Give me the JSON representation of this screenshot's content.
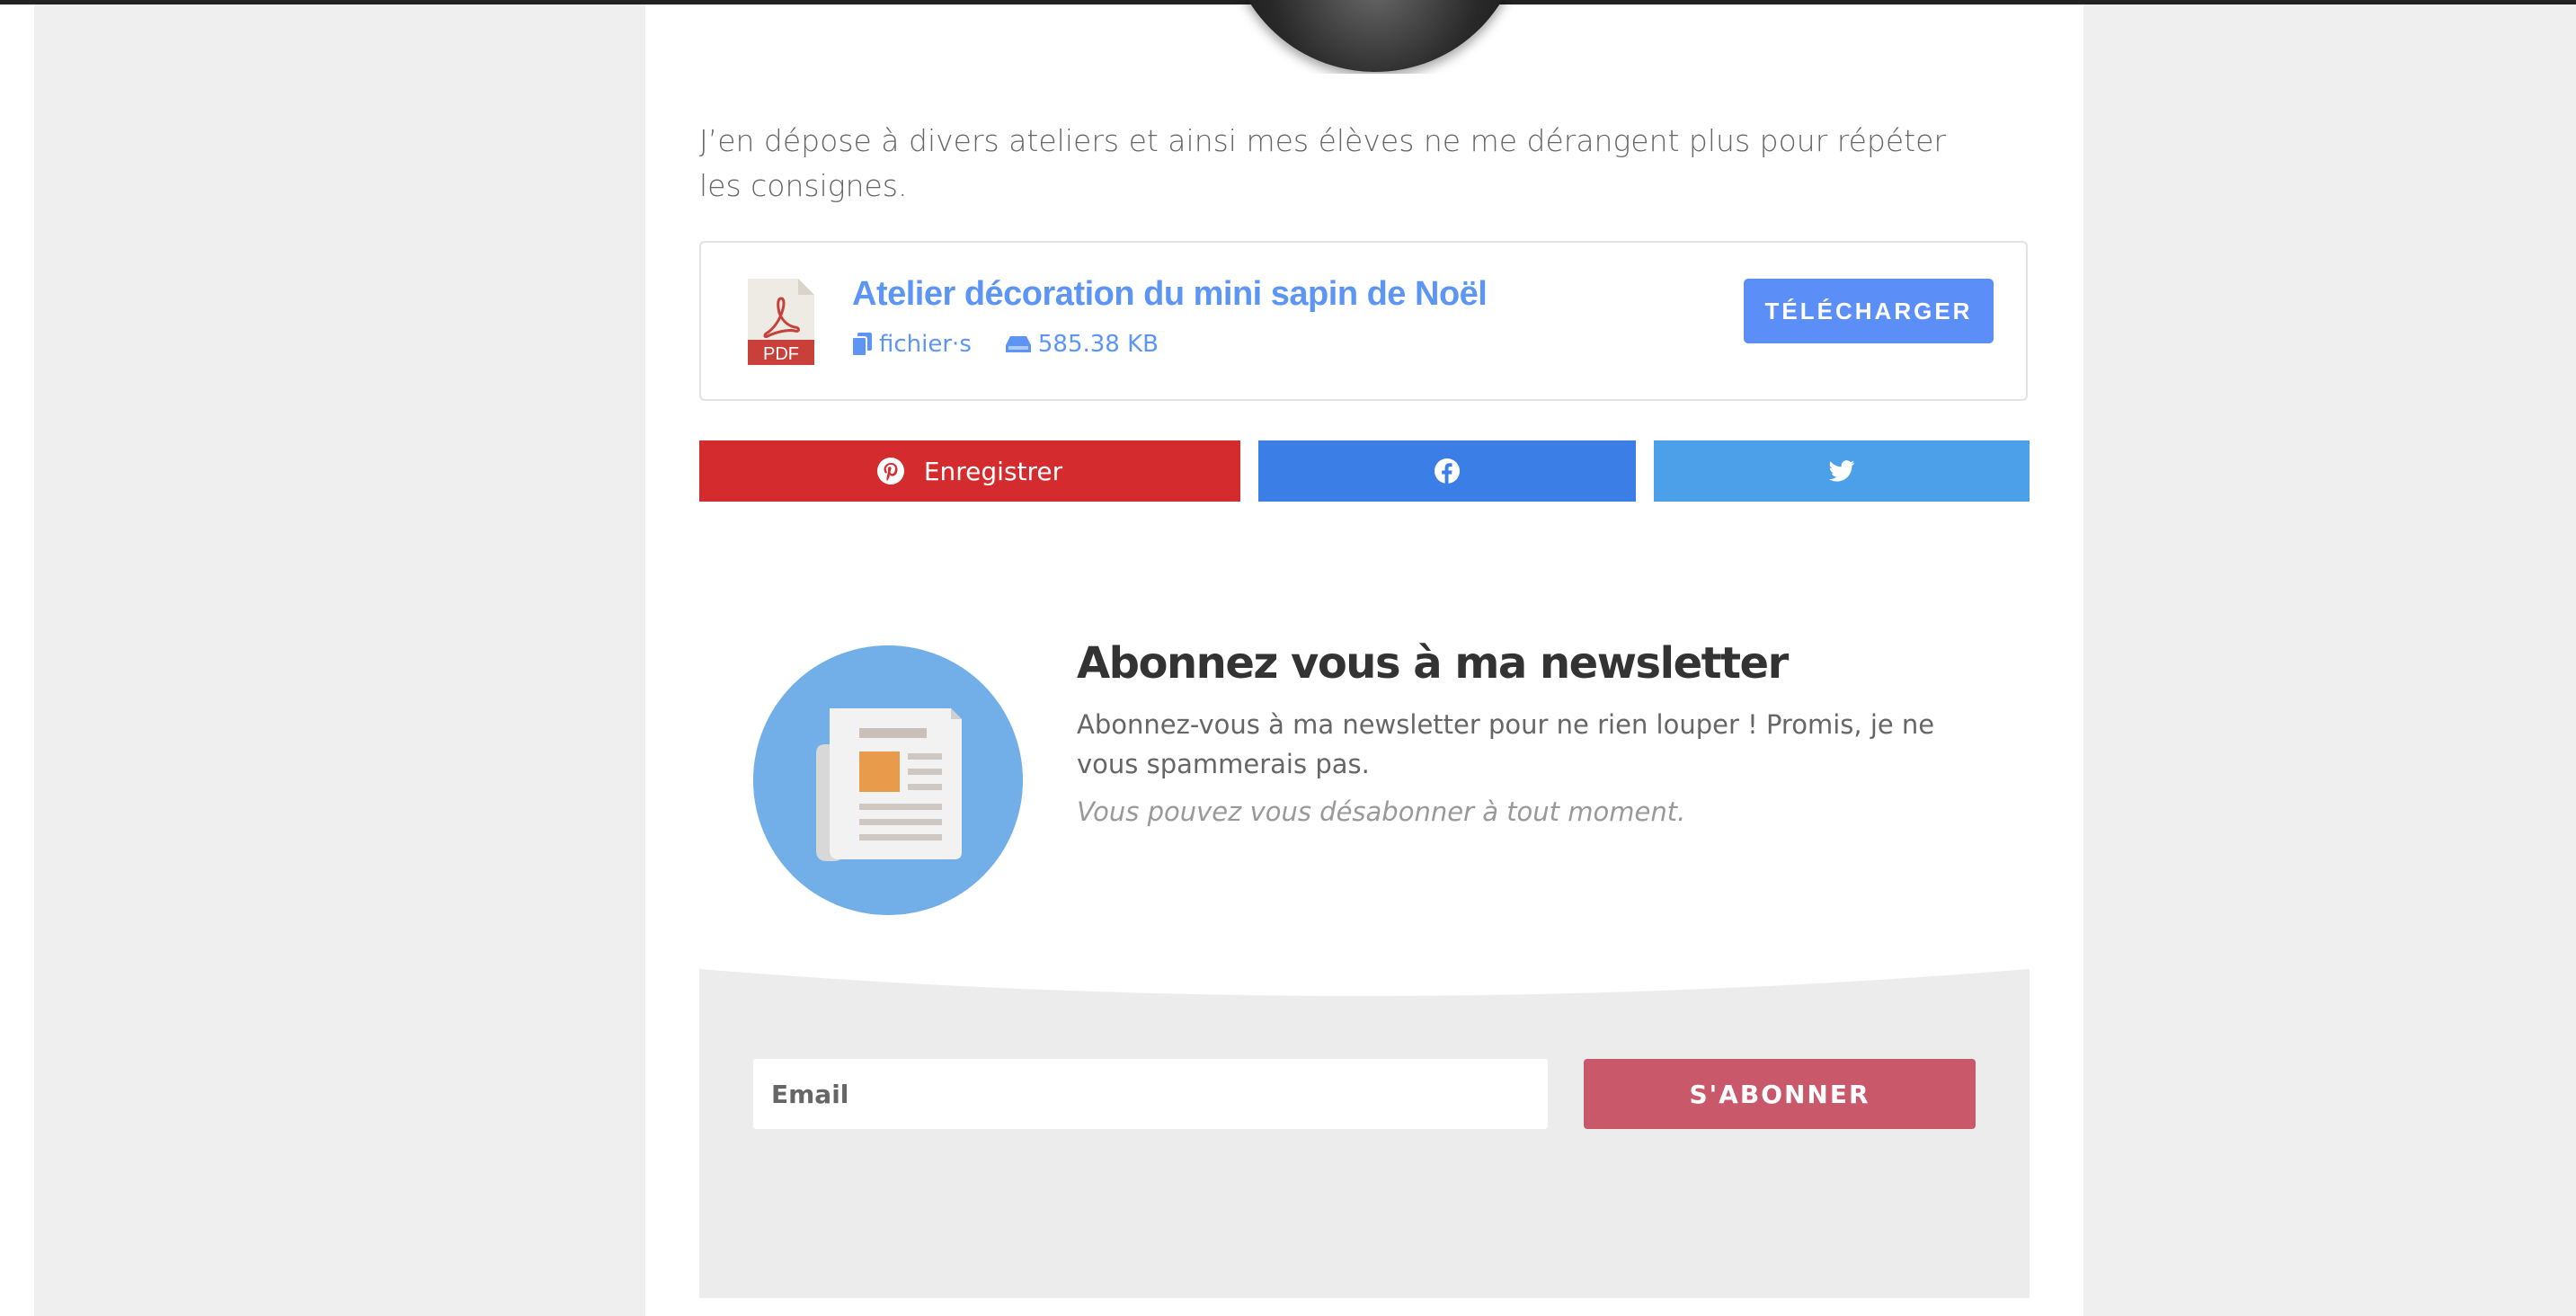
{
  "article": {
    "intro": "J’en dépose à divers ateliers et ainsi mes élèves ne me dérangent plus pour répéter les consignes."
  },
  "download": {
    "file_icon_label": "PDF",
    "title": "Atelier décoration du mini sapin de Noël",
    "files_label": "fichier·s",
    "size": "585.38 KB",
    "button_label": "TÉLÉCHARGER",
    "accent": "#5b8ff7"
  },
  "share": {
    "pinterest_label": "Enregistrer",
    "pinterest_color": "#d42b2f",
    "facebook_color": "#3b7ee6",
    "twitter_color": "#4ca0ea"
  },
  "newsletter": {
    "title": "Abonnez vous à ma newsletter",
    "description": "Abonnez-vous à ma newsletter pour ne rien louper ! Promis, je ne vous spammerais pas.",
    "unsubscribe_note": "Vous pouvez vous désabonner à tout moment.",
    "email_placeholder": "Email",
    "subscribe_label": "S'ABONNER",
    "button_color": "#c9586a"
  }
}
